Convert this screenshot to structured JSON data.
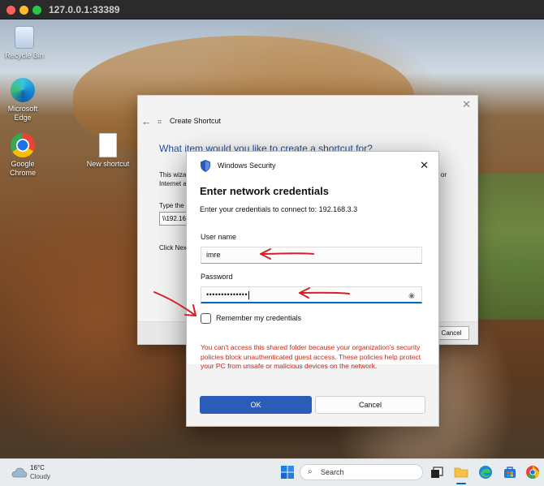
{
  "browser": {
    "url": "127.0.0.1:33389"
  },
  "desktop": {
    "icons": [
      {
        "label": "Recycle Bin"
      },
      {
        "label": "Microsoft Edge"
      },
      {
        "label": "Google Chrome"
      },
      {
        "label": "New shortcut"
      }
    ]
  },
  "create_shortcut": {
    "title": "Create Shortcut",
    "heading": "What item would you like to create a shortcut for?",
    "desc_line1": "This wiza",
    "desc_line2": "Internet a",
    "desc_or": "or",
    "type_label": "Type the",
    "location_value": "\\\\192.16",
    "click_next": "Click Nex",
    "cancel_label": "Cancel"
  },
  "windows_security": {
    "caption": "Windows Security",
    "heading": "Enter network credentials",
    "subtitle": "Enter your credentials to connect to: 192.168.3.3",
    "username_label": "User name",
    "username_value": "imre",
    "password_label": "Password",
    "password_value": "••••••••••••••",
    "remember_label": "Remember my credentials",
    "error_text": "You can't access this shared folder because your organization's security policies block unauthenticated guest access. These policies help protect your PC from unsafe or malicious devices on the network.",
    "ok_label": "OK",
    "cancel_label": "Cancel"
  },
  "taskbar": {
    "weather_temp": "16°C",
    "weather_condition": "Cloudy",
    "search_label": "Search"
  },
  "colors": {
    "accent": "#2b5cb7",
    "error": "#c42b1c",
    "annotation": "#d4202a"
  }
}
